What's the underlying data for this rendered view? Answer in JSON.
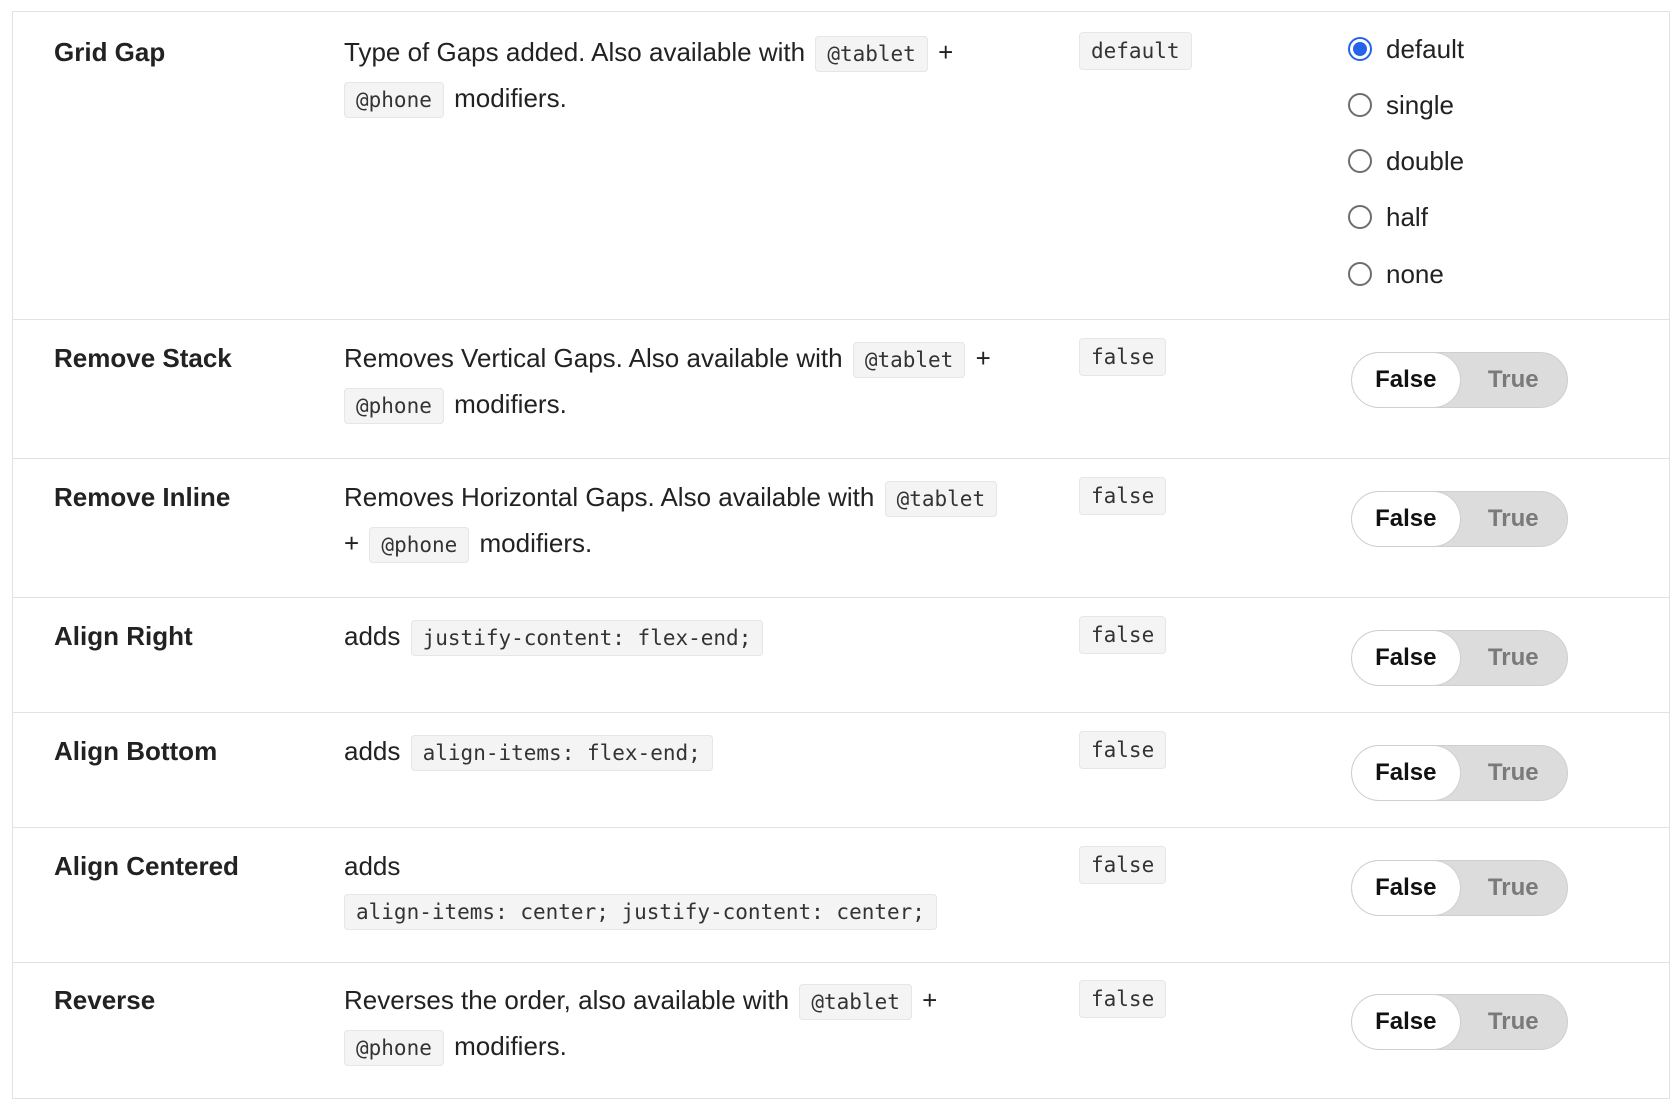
{
  "rows": [
    {
      "name": "Grid Gap",
      "desc_text": "Type of Gaps added. Also available with",
      "code1": "@tablet",
      "plus": "+",
      "code2": "@phone",
      "suffix": "modifiers.",
      "default": "default",
      "control": "radio",
      "options": [
        "default",
        "single",
        "double",
        "half",
        "none"
      ],
      "selected": "default"
    },
    {
      "name": "Remove Stack",
      "desc_text": "Removes Vertical Gaps. Also available with",
      "code1": "@tablet",
      "plus": "+",
      "code2": "@phone",
      "suffix": "modifiers.",
      "default": "false",
      "toggle": {
        "false_label": "False",
        "true_label": "True",
        "value": "False"
      }
    },
    {
      "name": "Remove Inline",
      "desc_text": "Removes Horizontal Gaps. Also available with",
      "code1": "@tablet",
      "plus": "+",
      "code2": "@phone",
      "suffix": "modifiers.",
      "default": "false",
      "toggle": {
        "false_label": "False",
        "true_label": "True",
        "value": "False"
      }
    },
    {
      "name": "Align Right",
      "desc_text": "adds",
      "code1": "justify-content: flex-end;",
      "default": "false",
      "toggle": {
        "false_label": "False",
        "true_label": "True",
        "value": "False"
      }
    },
    {
      "name": "Align Bottom",
      "desc_text": "adds",
      "code1": "align-items: flex-end;",
      "default": "false",
      "toggle": {
        "false_label": "False",
        "true_label": "True",
        "value": "False"
      }
    },
    {
      "name": "Align Centered",
      "desc_text": "adds",
      "code1": "align-items: center; justify-content: center;",
      "default": "false",
      "toggle": {
        "false_label": "False",
        "true_label": "True",
        "value": "False"
      }
    },
    {
      "name": "Reverse",
      "desc_text": "Reverses the order, also available with",
      "code1": "@tablet",
      "plus": "+",
      "code2": "@phone",
      "suffix": "modifiers.",
      "default": "false",
      "toggle": {
        "false_label": "False",
        "true_label": "True",
        "value": "False"
      }
    }
  ],
  "colors": {
    "radio_accent": "#2563eb",
    "toggle_track": "#dcdcdc",
    "border": "#e2e2e2"
  }
}
